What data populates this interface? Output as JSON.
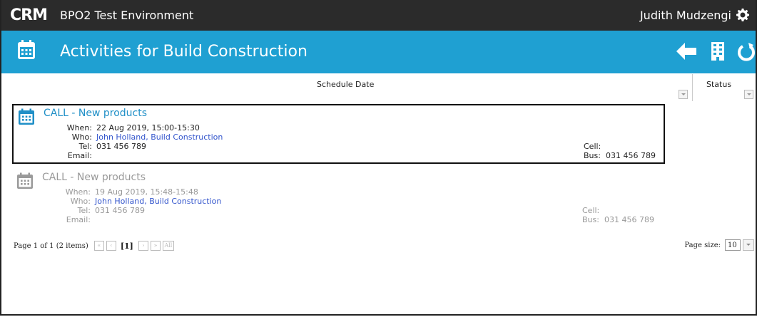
{
  "app": {
    "logo_text": "CRM",
    "environment": "BPO2 Test Environment",
    "user_name": "Judith Mudzengi"
  },
  "header": {
    "title": "Activities for Build Construction"
  },
  "columns": {
    "schedule_date": "Schedule Date",
    "status": "Status"
  },
  "labels": {
    "when": "When:",
    "who": "Who:",
    "tel": "Tel:",
    "email": "Email:",
    "cell": "Cell:",
    "bus": "Bus:"
  },
  "activities": [
    {
      "title": "CALL - New products",
      "when": "22 Aug 2019, 15:00-15:30",
      "who": "John Holland, Build Construction",
      "tel": "031 456 789",
      "email": "",
      "cell": "",
      "bus": "031 456 789",
      "selected": true
    },
    {
      "title": "CALL - New products",
      "when": "19 Aug 2019, 15:48-15:48",
      "who": "John Holland, Build Construction",
      "tel": "031 456 789",
      "email": "",
      "cell": "",
      "bus": "031 456 789",
      "selected": false
    }
  ],
  "pager": {
    "summary": "Page 1 of 1 (2 items)",
    "first": "«",
    "prev": "‹",
    "current": "[1]",
    "next": "›",
    "last": "»",
    "all": "All",
    "page_size_label": "Page size:",
    "page_size_value": "10"
  },
  "colors": {
    "topbar": "#2b2b2b",
    "header": "#1fa0d2",
    "link": "#3355cc",
    "title_active": "#1f8fc7",
    "text_inactive": "#999999"
  }
}
